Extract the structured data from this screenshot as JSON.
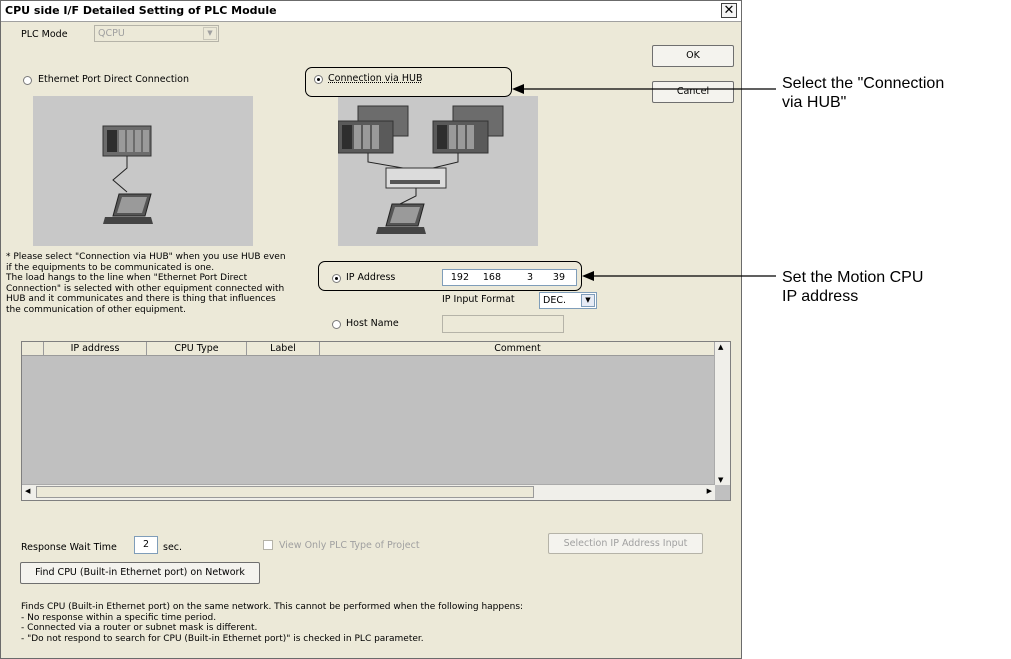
{
  "window": {
    "title": "CPU side I/F Detailed Setting of PLC Module",
    "close_glyph": "✕"
  },
  "plc_mode": {
    "label": "PLC Mode",
    "value": "QCPU"
  },
  "buttons": {
    "ok": "OK",
    "cancel": "Cancel"
  },
  "connection": {
    "direct_label": "Ethernet Port Direct Connection",
    "hub_label": "Connection via HUB",
    "selected": "hub"
  },
  "note_lines": [
    "* Please select \"Connection via HUB\" when you use HUB even",
    "if the equipments to be communicated is one.",
    "The load hangs to the line when \"Ethernet Port Direct",
    "Connection\" is selected with other equipment connected with",
    "HUB and it communicates and there is thing that influences",
    "the communication of other equipment."
  ],
  "ip": {
    "ip_label": "IP Address",
    "octets": [
      "192",
      "168",
      "3",
      "39"
    ],
    "format_label": "IP Input Format",
    "format_value": "DEC.",
    "host_label": "Host Name",
    "host_value": ""
  },
  "table": {
    "columns": [
      "IP address",
      "CPU Type",
      "Label",
      "Comment"
    ],
    "rows": []
  },
  "response_wait": {
    "label": "Response Wait Time",
    "value": "2",
    "unit": "sec."
  },
  "view_only_label": "View Only PLC Type of Project",
  "selection_ip_button": "Selection IP Address Input",
  "find_button": "Find CPU (Built-in Ethernet port) on Network",
  "find_note_lines": [
    "Finds CPU (Built-in Ethernet port) on the same network. This cannot be performed when the following happens:",
    "- No response within a specific time period.",
    "- Connected via a router or subnet mask is different.",
    "- \"Do not respond to search for CPU (Built-in Ethernet port)\" is checked in PLC parameter."
  ],
  "annotations": {
    "hub_line1": "Select the \"Connection",
    "hub_line2": "via HUB\"",
    "ip_line1": "Set the Motion CPU",
    "ip_line2": "IP address"
  }
}
